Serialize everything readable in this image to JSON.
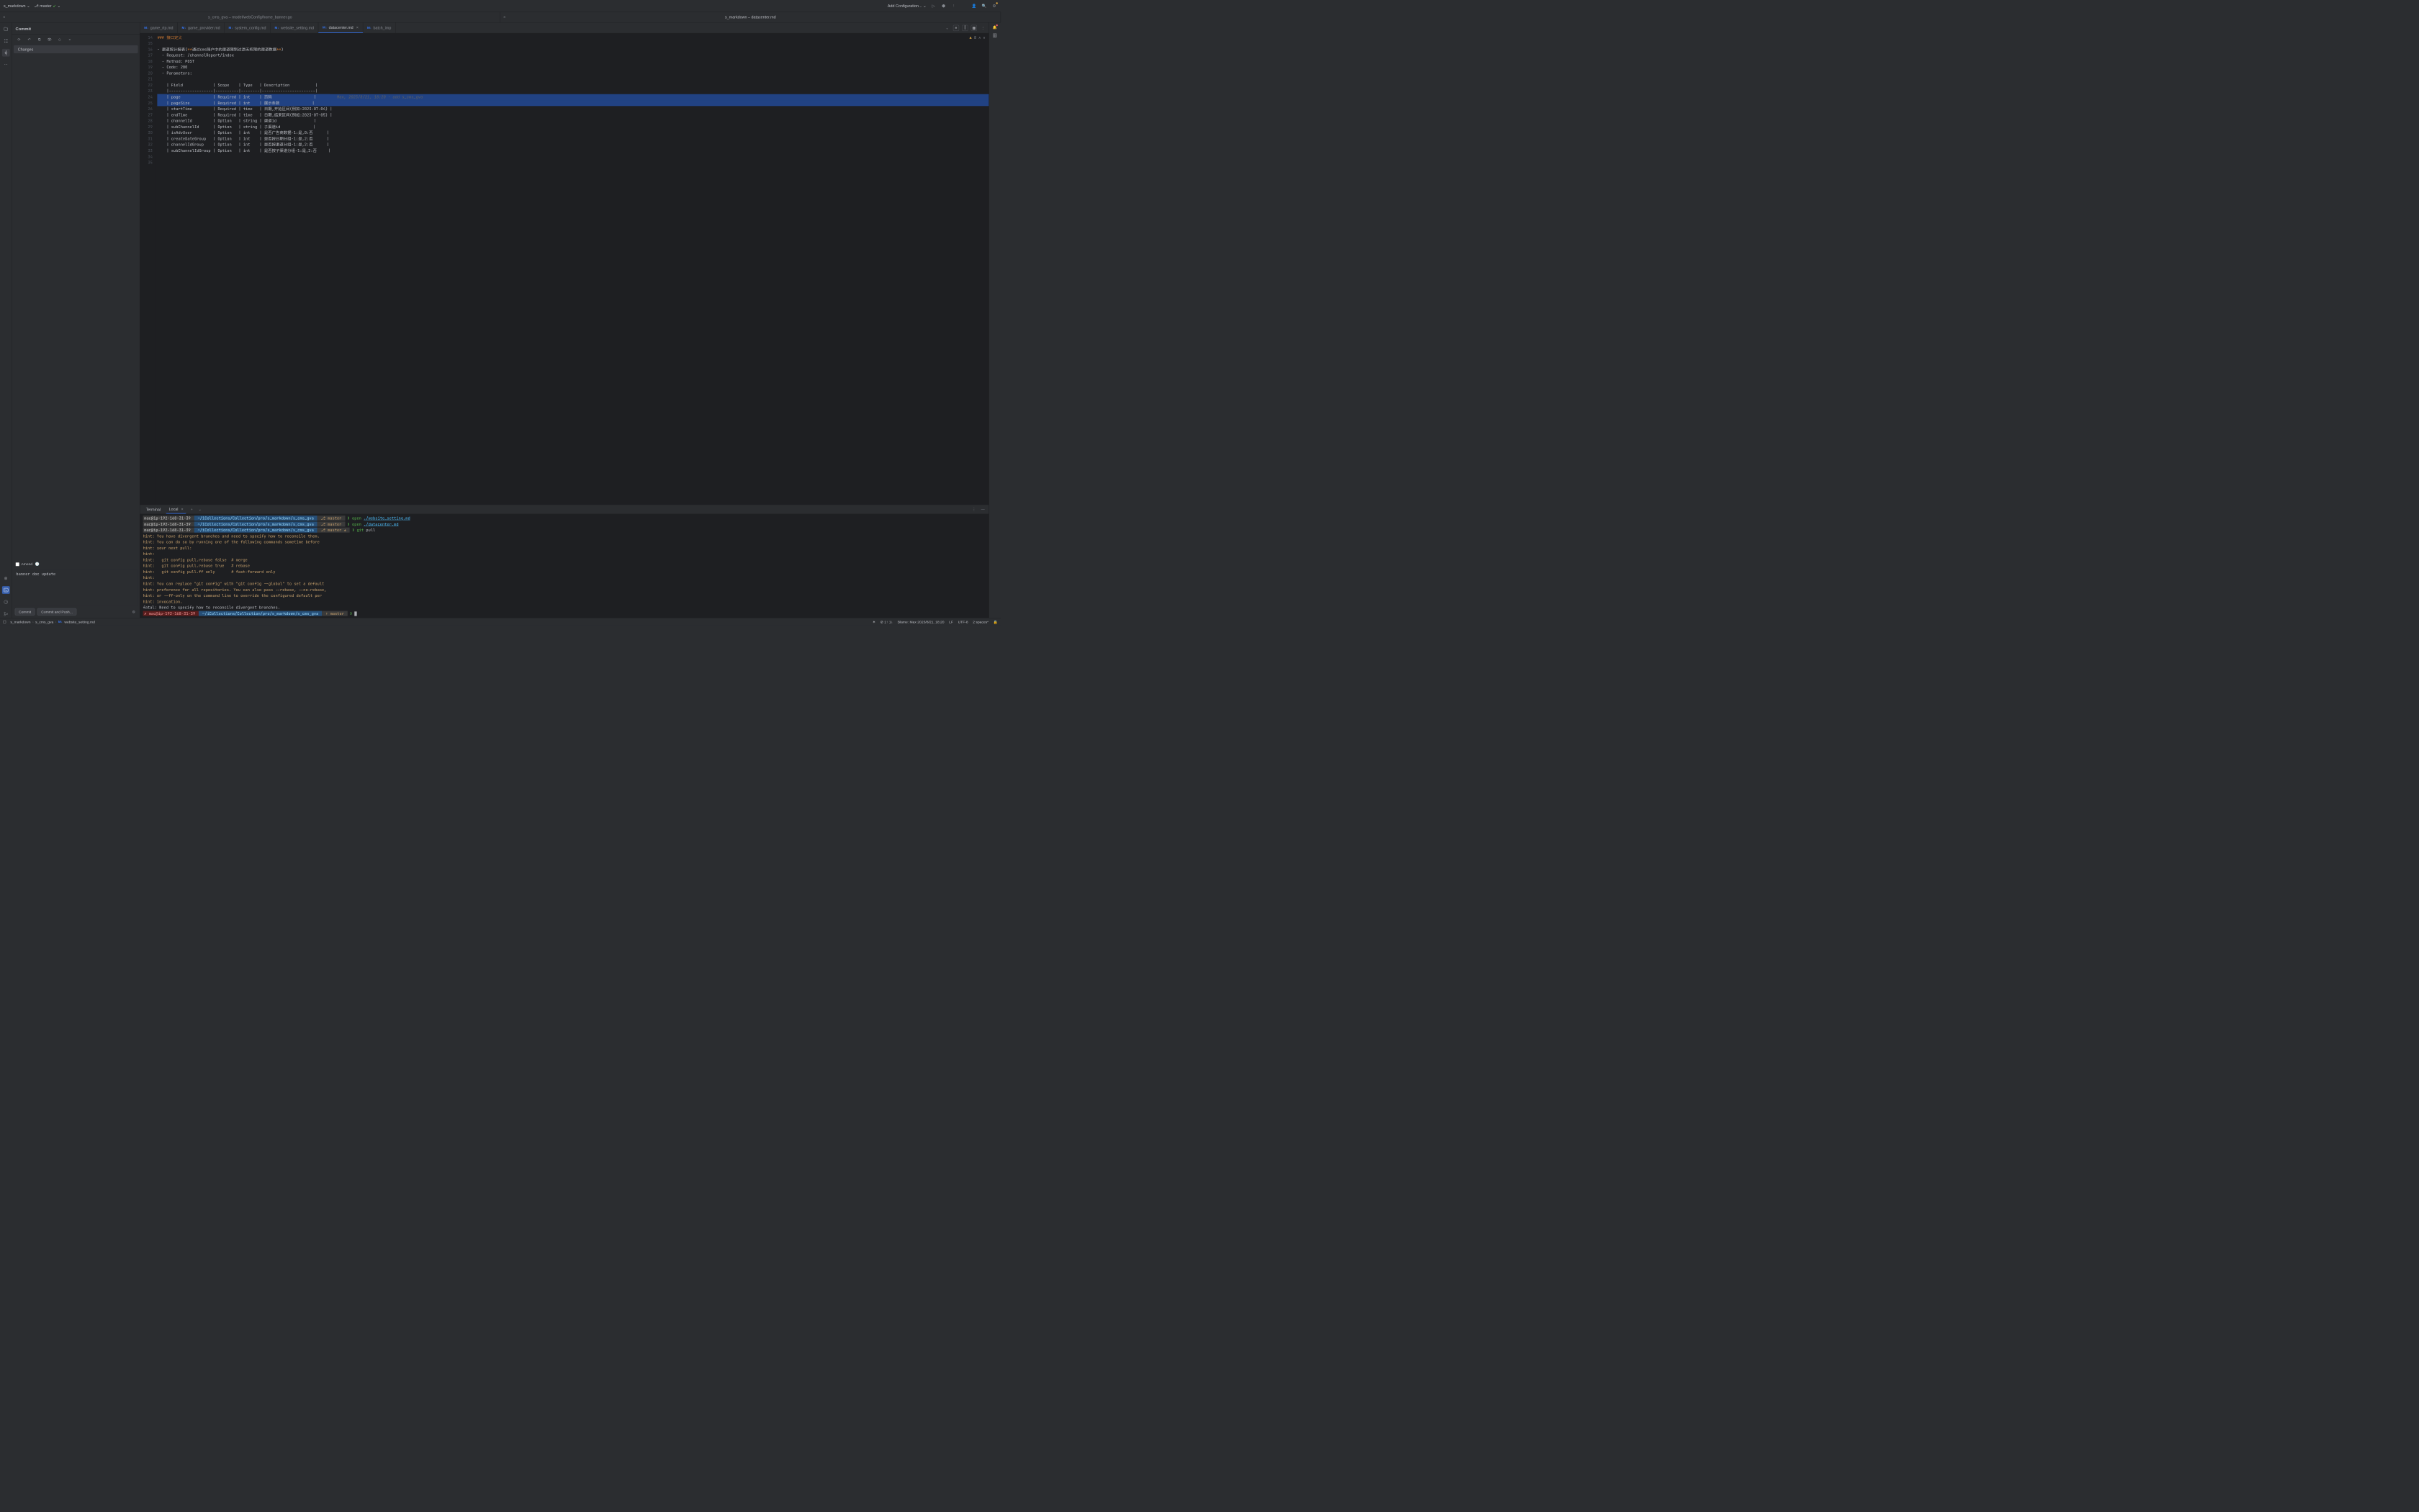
{
  "topbar": {
    "project": "s_markdown",
    "branch": "master",
    "config": "Add Configuration..."
  },
  "mainTabs": [
    {
      "label": "s_cms_gva – model/webConfig/home_banner.go",
      "active": false
    },
    {
      "label": "s_markdown – datacenter.md",
      "active": true
    }
  ],
  "commitPanel": {
    "title": "Commit",
    "changesLabel": "Changes",
    "amendLabel": "Amend",
    "message": "banner doc update",
    "commitBtn": "Commit",
    "pushBtn": "Commit and Push..."
  },
  "fileTabs": [
    {
      "label": "game_rtp.md",
      "active": false
    },
    {
      "label": "game_provider.md",
      "active": false
    },
    {
      "label": "system_config.md",
      "active": false
    },
    {
      "label": "website_setting.md",
      "active": false
    },
    {
      "label": "datacenter.md",
      "active": true,
      "closable": true
    },
    {
      "label": "batch_imp",
      "active": false
    }
  ],
  "editor": {
    "warnCount": "8",
    "startLine": 14,
    "blame": "Max, 2023/8/21, 18:20 · add s_cms_gva",
    "lines": [
      "### 接口定义",
      "",
      "- 渠道统计报表(**通过cms账户中的渠道限制过滤无权限的渠道数据**)",
      "  - Request: /channelReport/index",
      "  - Method: POST",
      "  - Code: 200",
      "  - Parameters:",
      "",
      "    | Field             | Scope    | Type   | Description           |",
      "    |-------------------|----------|--------|-----------------------|",
      "    | page              | Required | int    | 页码                  |",
      "    | pageSize          | Required | int    | 展示条数              |",
      "    | startTime         | Required | time   | 日期,开始区间(例如:2023-07-04) |",
      "    | endTime           | Required | time   | 日期,结束区间(例如:2023-07-05) |",
      "    | channelId         | Option   | string | 渠道id                |",
      "    | subChannelId      | Option   | string | 子渠道id              |",
      "    | isAdvUser         | Option   | int    | 是否广告商数据-1:是,0:否      |",
      "    | createDateGroup   | Option   | int    | 是否按日期分组-1:是,2:否      |",
      "    | channelIdGroup    | Option   | int    | 是否按渠道分组-1:是,2:否      |",
      "    | subChannelIdGroup | Option   | int    | 是否按子渠道分组-1:是,2:否     |",
      "",
      ""
    ],
    "selectedLines": [
      24,
      25
    ]
  },
  "terminal": {
    "titleTab": "Terminal",
    "localTab": "Local",
    "host": "mac@ip-192-168-31-39",
    "path": "~/iCollections/Collection/pro/s_markdown/s_cms_gva",
    "lines": [
      {
        "type": "prompt",
        "branch": "⎇ master",
        "cmd": "open",
        "arg": "./website_setting.md"
      },
      {
        "type": "prompt",
        "branch": "⎇ master",
        "cmd": "open",
        "arg": "./datacenter.md"
      },
      {
        "type": "prompt",
        "branch": "⎇ master ±",
        "cmd": "git",
        "arg": "pull",
        "argPlain": true
      },
      {
        "type": "hint",
        "text": "hint: You have divergent branches and need to specify how to reconcile them."
      },
      {
        "type": "hint",
        "text": "hint: You can do so by running one of the following commands sometime before"
      },
      {
        "type": "hint",
        "text": "hint: your next pull:"
      },
      {
        "type": "hint",
        "text": "hint:"
      },
      {
        "type": "hint",
        "text": "hint:   git config pull.rebase false  # merge"
      },
      {
        "type": "hint",
        "text": "hint:   git config pull.rebase true   # rebase"
      },
      {
        "type": "hint",
        "text": "hint:   git config pull.ff only       # fast-forward only"
      },
      {
        "type": "hint",
        "text": "hint:"
      },
      {
        "type": "hint",
        "text": "hint: You can replace \"git config\" with \"git config --global\" to set a default"
      },
      {
        "type": "hint",
        "text": "hint: preference for all repositories. You can also pass --rebase, --no-rebase,"
      },
      {
        "type": "hint",
        "text": "hint: or --ff-only on the command line to override the configured default per"
      },
      {
        "type": "hint",
        "text": "hint: invocation."
      },
      {
        "type": "fatal",
        "text": "fatal: Need to specify how to reconcile divergent branches."
      },
      {
        "type": "prompt-cursor",
        "host": "✗ mac@ip-192-168-31-39",
        "branch": "⇡ master"
      }
    ]
  },
  "statusbar": {
    "crumbs": [
      "s_markdown",
      "s_cms_gva",
      "website_setting.md"
    ],
    "upDown": "⊘ 1↑ 1↓",
    "blame": "Blame: Max 2023/8/21, 18:20",
    "lf": "LF",
    "enc": "UTF-8",
    "indent": "2 spaces*"
  }
}
